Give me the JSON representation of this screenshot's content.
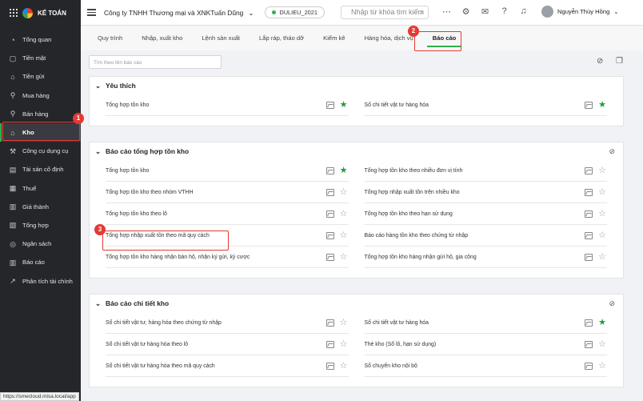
{
  "app": {
    "logo_text": "KẾ TOÁN",
    "company": "Công ty TNHH Thương mại và XNKTuấn Dũng",
    "database": "DULIEU_2021",
    "search_placeholder": "Nhập từ khóa tìm kiếm",
    "user_name": "Nguyễn Thùy Hồng",
    "status_url": "https://smecloud.misa.local/app"
  },
  "sidebar": {
    "items": [
      {
        "label": "Tổng quan",
        "icon": "dashboard"
      },
      {
        "label": "Tiền mặt",
        "icon": "cash"
      },
      {
        "label": "Tiền gửi",
        "icon": "bank"
      },
      {
        "label": "Mua hàng",
        "icon": "cart"
      },
      {
        "label": "Bán hàng",
        "icon": "cart"
      },
      {
        "label": "Kho",
        "icon": "warehouse",
        "active": true
      },
      {
        "label": "Công cụ dụng cụ",
        "icon": "tools"
      },
      {
        "label": "Tài sản cố định",
        "icon": "asset"
      },
      {
        "label": "Thuế",
        "icon": "tax"
      },
      {
        "label": "Giá thành",
        "icon": "price"
      },
      {
        "label": "Tổng hợp",
        "icon": "summary"
      },
      {
        "label": "Ngân sách",
        "icon": "budget"
      },
      {
        "label": "Báo cáo",
        "icon": "report"
      },
      {
        "label": "Phân tích tài chính",
        "icon": "analysis"
      }
    ]
  },
  "tabs": [
    "Quy trình",
    "Nhập, xuất kho",
    "Lệnh sản xuất",
    "Lắp ráp, tháo dỡ",
    "Kiểm kê",
    "Hàng hóa, dịch vụ",
    "Báo cáo"
  ],
  "active_tab": "Báo cáo",
  "filter_placeholder": "Tìm theo tên báo cáo",
  "annotations": [
    "1",
    "2",
    "3"
  ],
  "sections": [
    {
      "title": "Yêu thích",
      "left": [
        {
          "label": "Tổng hợp tồn kho",
          "fav": true
        }
      ],
      "right": [
        {
          "label": "Sổ chi tiết vật tư hàng hóa",
          "fav": true
        }
      ]
    },
    {
      "title": "Báo cáo tổng hợp tồn kho",
      "left": [
        {
          "label": "Tổng hợp tồn kho",
          "fav": true
        },
        {
          "label": "Tổng hợp tồn kho theo nhóm VTHH",
          "fav": false
        },
        {
          "label": "Tổng hợp tồn kho theo lô",
          "fav": false
        },
        {
          "label": "Tổng hợp nhập xuất tồn theo mã quy cách",
          "fav": false
        },
        {
          "label": "Tổng hợp tồn kho hàng nhận bán hộ, nhận ký gửi, ký cược",
          "fav": false
        }
      ],
      "right": [
        {
          "label": "Tổng hợp tồn kho theo nhiều đơn vị tính",
          "fav": false
        },
        {
          "label": "Tổng hợp nhập xuất tồn trên nhiều kho",
          "fav": false
        },
        {
          "label": "Tổng hợp tồn kho theo hạn sử dụng",
          "fav": false
        },
        {
          "label": "Báo cáo hàng tồn kho theo chứng từ nhập",
          "fav": false
        },
        {
          "label": "Tổng hợp tồn kho hàng nhận gửi hộ, gia công",
          "fav": false
        }
      ]
    },
    {
      "title": "Báo cáo chi tiết kho",
      "left": [
        {
          "label": "Sổ chi tiết vật tư, hàng hóa theo chứng từ nhập",
          "fav": false
        },
        {
          "label": "Sổ chi tiết vật tư hàng hóa theo lô",
          "fav": false
        },
        {
          "label": "Sổ chi tiết vật tư hàng hóa theo mã quy cách",
          "fav": false
        }
      ],
      "right": [
        {
          "label": "Sổ chi tiết vật tư hàng hóa",
          "fav": true
        },
        {
          "label": "Thẻ kho (Sổ lô, hạn sử dụng)",
          "fav": false
        },
        {
          "label": "Sổ chuyển kho nội bộ",
          "fav": false
        }
      ]
    }
  ]
}
